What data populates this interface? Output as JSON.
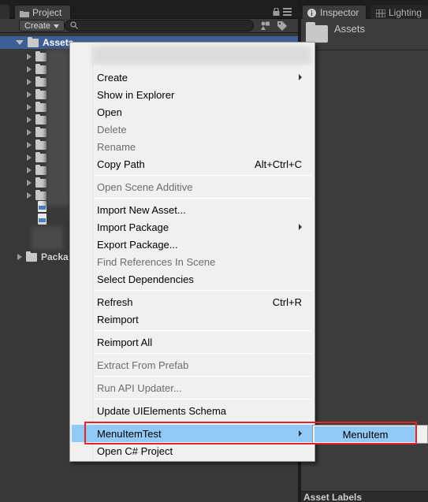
{
  "tabs": {
    "project": "Project",
    "inspector": "Inspector",
    "lighting": "Lighting"
  },
  "toolbar": {
    "create_label": "Create"
  },
  "tree": {
    "root": "Assets",
    "packages": "Packa"
  },
  "inspector": {
    "title": "Assets",
    "footer": "Asset Labels"
  },
  "menu": {
    "items": [
      {
        "label": "Create",
        "shortcut": "",
        "disabled": false,
        "submenu": true
      },
      {
        "label": "Show in Explorer",
        "shortcut": "",
        "disabled": false,
        "submenu": false
      },
      {
        "label": "Open",
        "shortcut": "",
        "disabled": false,
        "submenu": false
      },
      {
        "label": "Delete",
        "shortcut": "",
        "disabled": true,
        "submenu": false
      },
      {
        "label": "Rename",
        "shortcut": "",
        "disabled": true,
        "submenu": false
      },
      {
        "label": "Copy Path",
        "shortcut": "Alt+Ctrl+C",
        "disabled": false,
        "submenu": false
      },
      {
        "label": "Open Scene Additive",
        "shortcut": "",
        "disabled": true,
        "submenu": false
      },
      {
        "label": "Import New Asset...",
        "shortcut": "",
        "disabled": false,
        "submenu": false
      },
      {
        "label": "Import Package",
        "shortcut": "",
        "disabled": false,
        "submenu": true
      },
      {
        "label": "Export Package...",
        "shortcut": "",
        "disabled": false,
        "submenu": false
      },
      {
        "label": "Find References In Scene",
        "shortcut": "",
        "disabled": true,
        "submenu": false
      },
      {
        "label": "Select Dependencies",
        "shortcut": "",
        "disabled": false,
        "submenu": false
      },
      {
        "label": "Refresh",
        "shortcut": "Ctrl+R",
        "disabled": false,
        "submenu": false
      },
      {
        "label": "Reimport",
        "shortcut": "",
        "disabled": false,
        "submenu": false
      },
      {
        "label": "Reimport All",
        "shortcut": "",
        "disabled": false,
        "submenu": false
      },
      {
        "label": "Extract From Prefab",
        "shortcut": "",
        "disabled": true,
        "submenu": false
      },
      {
        "label": "Run API Updater...",
        "shortcut": "",
        "disabled": true,
        "submenu": false
      },
      {
        "label": "Update UIElements Schema",
        "shortcut": "",
        "disabled": false,
        "submenu": false
      },
      {
        "label": "MenuItemTest",
        "shortcut": "",
        "disabled": false,
        "submenu": true,
        "highlighted": true
      },
      {
        "label": "Open C# Project",
        "shortcut": "",
        "disabled": false,
        "submenu": false
      }
    ]
  },
  "submenu": {
    "item": "MenuItem"
  },
  "colors": {
    "menu_bg": "#f0f0f0",
    "menu_hover": "#91c9f7",
    "selection": "#3e5f96",
    "highlight_box": "#e8222a",
    "disabled_text": "#6d6d6d"
  }
}
